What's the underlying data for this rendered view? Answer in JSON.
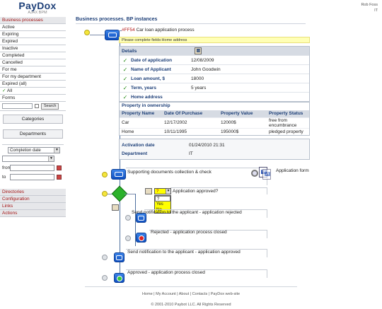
{
  "header": {
    "logo": "PayDox",
    "logo_sub": "AJAX BPM",
    "user_name": "Rob Foss",
    "user_dept": "IT"
  },
  "sidebar": {
    "section": "Business processes",
    "items": [
      "Active",
      "Expiring",
      "Expired",
      "Inactive",
      "Completed",
      "Cancelled",
      "For me",
      "For my department",
      "Expired (all)",
      "All",
      "Forms"
    ],
    "search_button": "Search",
    "categories_button": "Categories",
    "departments_button": "Departments",
    "sort_select": "Completion date",
    "from_label": "from",
    "to_label": "to",
    "bottom_items": [
      "Directories",
      "Configuration",
      "Links",
      "Actions"
    ]
  },
  "breadcrumb": "Business processes. BP instances",
  "process": {
    "code": "#FF54",
    "title": "Car loan application process",
    "warning": "Please complete fields:Home address"
  },
  "details": {
    "header": "Details",
    "rows": [
      {
        "key": "Date of application",
        "value": "12/08/2009"
      },
      {
        "key": "Name of Applicant",
        "value": "John Goodwin"
      },
      {
        "key": "Loan amount, $",
        "value": "18000"
      },
      {
        "key": "Term, years",
        "value": "5 years"
      },
      {
        "key": "Home address",
        "value": ""
      }
    ]
  },
  "ownership": {
    "title": "Property in ownership",
    "columns": [
      "Property Name",
      "Date Of Purchase",
      "Property Value",
      "Property Status"
    ],
    "rows": [
      [
        "Car",
        "12/17/2002",
        "12000$",
        "free from encumbrance"
      ],
      [
        "Home",
        "10/11/1995",
        "195000$",
        "pledged property"
      ]
    ]
  },
  "activation": {
    "rows": [
      {
        "key": "Activation date",
        "value": "01/24/2010 21:31"
      },
      {
        "key": "Department",
        "value": "IT"
      }
    ]
  },
  "workflow": {
    "step1": "Supporting documents collection & check",
    "form_label": "Application form",
    "question": "Application approved?",
    "answer_selected": "?",
    "answer_options": [
      "?",
      "Yes",
      "No"
    ],
    "step_reject_notify": "Send notification to the applicant - application rejected",
    "step_rejected": "Rejected - application process closed",
    "step_approve_notify": "Send notification to the applicant - application approved",
    "step_approved": "Approved - application process closed"
  },
  "footer": {
    "links": "Home | My Account | About | Contacts | PayDox web-site",
    "copyright": "© 2001-2010 Paybot LLC. All Rights Reserved"
  }
}
